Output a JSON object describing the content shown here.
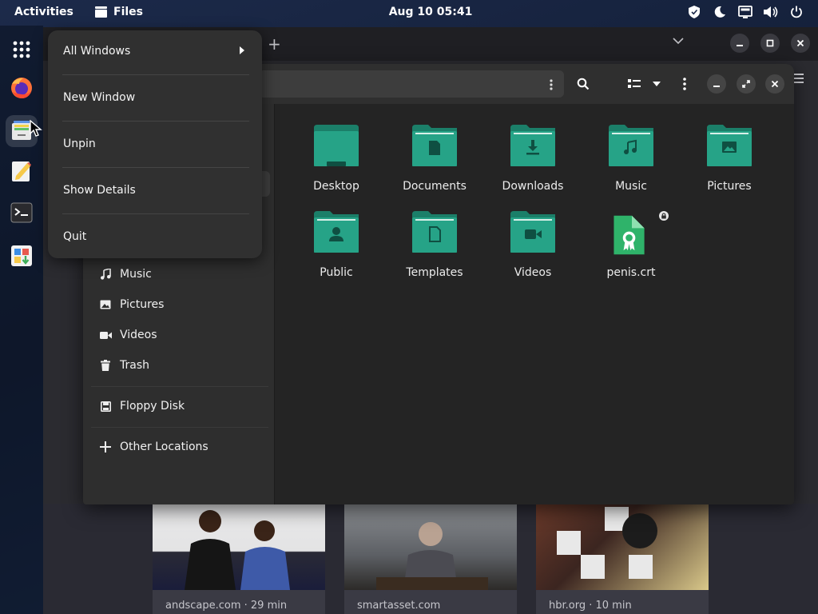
{
  "topbar": {
    "activities": "Activities",
    "app_name": "Files",
    "clock": "Aug 10  05:41",
    "tray_icons": [
      "shield-icon",
      "night-light-icon",
      "screen-share-icon",
      "volume-icon",
      "power-icon"
    ]
  },
  "dock": {
    "apps": [
      "app-grid-icon",
      "firefox-icon",
      "files-icon",
      "text-editor-icon",
      "terminal-icon",
      "software-icon"
    ]
  },
  "app_menu": {
    "items": [
      {
        "label": "All Windows",
        "has_submenu": true
      },
      {
        "label": "New Window"
      },
      {
        "label": "Unpin"
      },
      {
        "label": "Show Details"
      },
      {
        "label": "Quit"
      }
    ]
  },
  "files": {
    "sidebar": [
      {
        "label": "Music",
        "icon": "music-note-icon"
      },
      {
        "label": "Pictures",
        "icon": "picture-icon"
      },
      {
        "label": "Videos",
        "icon": "video-camera-icon"
      },
      {
        "label": "Trash",
        "icon": "trash-icon"
      },
      {
        "label": "Floppy Disk",
        "icon": "floppy-disk-icon"
      },
      {
        "label": "Other Locations",
        "icon": "plus-icon"
      }
    ],
    "items": [
      {
        "label": "Desktop",
        "icon": "folder-desktop-icon"
      },
      {
        "label": "Documents",
        "icon": "folder-documents-icon"
      },
      {
        "label": "Downloads",
        "icon": "folder-downloads-icon"
      },
      {
        "label": "Music",
        "icon": "folder-music-icon"
      },
      {
        "label": "Pictures",
        "icon": "folder-pictures-icon"
      },
      {
        "label": "Public",
        "icon": "folder-public-icon"
      },
      {
        "label": "Templates",
        "icon": "folder-templates-icon"
      },
      {
        "label": "Videos",
        "icon": "folder-videos-icon"
      },
      {
        "label": "penis.crt",
        "icon": "certificate-file-icon",
        "locked": true
      }
    ]
  },
  "browser": {
    "cards": [
      {
        "source": "andscape.com · 29 min"
      },
      {
        "source": "smartasset.com"
      },
      {
        "source": "hbr.org · 10 min"
      }
    ]
  },
  "colors": {
    "folder": "#26a387",
    "folder_dark": "#1b7f69",
    "menu_bg": "#303030",
    "window_bg": "#242424"
  }
}
